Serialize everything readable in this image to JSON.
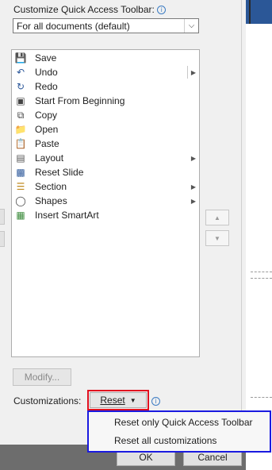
{
  "dialog": {
    "qat_label": "Customize Quick Access Toolbar:",
    "qat_scope_value": "For all documents (default)",
    "customizations_label": "Customizations:",
    "modify_label": "Modify...",
    "reset_label": "Reset",
    "ok_label": "OK",
    "cancel_label": "Cancel"
  },
  "toolbar_items": [
    {
      "label": "Save",
      "icon": "save-icon",
      "has_submenu": false
    },
    {
      "label": "Undo",
      "icon": "undo-icon",
      "has_submenu": true
    },
    {
      "label": "Redo",
      "icon": "redo-icon",
      "has_submenu": false
    },
    {
      "label": "Start From Beginning",
      "icon": "slideshow-icon",
      "has_submenu": false
    },
    {
      "label": "Copy",
      "icon": "copy-icon",
      "has_submenu": false
    },
    {
      "label": "Open",
      "icon": "folder-icon",
      "has_submenu": false
    },
    {
      "label": "Paste",
      "icon": "paste-icon",
      "has_submenu": false
    },
    {
      "label": "Layout",
      "icon": "layout-icon",
      "has_submenu": true
    },
    {
      "label": "Reset Slide",
      "icon": "reset-slide-icon",
      "has_submenu": false
    },
    {
      "label": "Section",
      "icon": "section-icon",
      "has_submenu": true
    },
    {
      "label": "Shapes",
      "icon": "shapes-icon",
      "has_submenu": true
    },
    {
      "label": "Insert SmartArt",
      "icon": "smartart-icon",
      "has_submenu": false
    }
  ],
  "reset_menu": {
    "items": [
      "Reset only Quick Access Toolbar",
      "Reset all customizations"
    ]
  },
  "colors": {
    "highlight_red": "#e01020",
    "highlight_blue": "#1a1ae0",
    "accent": "#2b579a"
  }
}
